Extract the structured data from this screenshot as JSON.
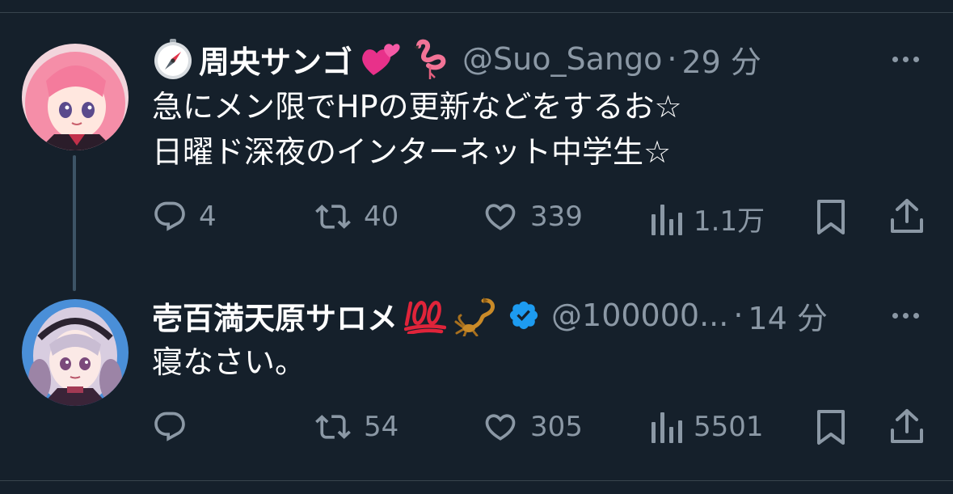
{
  "tweets": [
    {
      "display_name": "周央サンゴ",
      "handle": "@Suo_Sango",
      "separator": "·",
      "time": "29 分",
      "name_emojis": [
        "compass-icon",
        "two-hearts-icon",
        "flamingo-icon"
      ],
      "lines": [
        "急にメン限でHPの更新などをするお☆",
        "日曜ド深夜のインターネット中学生☆"
      ],
      "actions": {
        "replies": "4",
        "retweets": "40",
        "likes": "339",
        "views": "1.1万"
      }
    },
    {
      "display_name": "壱百満天原サロメ",
      "handle": "@100000...",
      "separator": "·",
      "time": "14 分",
      "name_emojis": [
        "hundred-points-icon",
        "scorpion-icon",
        "verified-badge-icon"
      ],
      "lines": [
        "寝なさい。"
      ],
      "actions": {
        "replies": "",
        "retweets": "54",
        "likes": "305",
        "views": "5501"
      }
    }
  ],
  "colors": {
    "background": "#15202b",
    "text_primary": "#ffffff",
    "text_secondary": "#8b98a5",
    "verified": "#1d9bf0",
    "thread_line": "#3d5466"
  }
}
